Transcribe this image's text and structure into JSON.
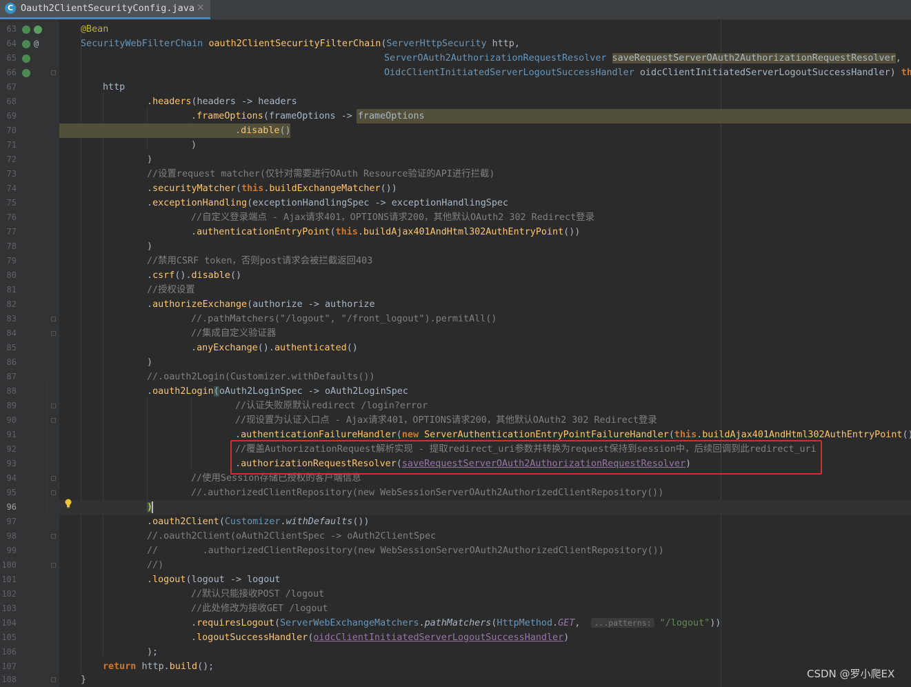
{
  "tab": {
    "title": "Oauth2ClientSecurityConfig.java",
    "close": "×",
    "icon_letter": "C"
  },
  "gutter": {
    "line_numbers": [
      "63",
      "64",
      "65",
      "66",
      "67",
      "68",
      "69",
      "70",
      "71",
      "72",
      "73",
      "74",
      "75",
      "76",
      "77",
      "78",
      "79",
      "80",
      "81",
      "82",
      "83",
      "84",
      "85",
      "86",
      "87",
      "88",
      "89",
      "90",
      "91",
      "92",
      "93",
      "94",
      "95",
      "96",
      "97",
      "98",
      "99",
      "100",
      "101",
      "102",
      "103",
      "104",
      "105",
      "106",
      "107",
      "108"
    ],
    "current_line": "96",
    "at_marker": "@"
  },
  "code": {
    "l63": {
      "annotation": "@Bean"
    },
    "l64": {
      "type": "SecurityWebFilterChain",
      "method": "oauth2ClientSecurityFilterChain",
      "open": "(",
      "ptype": "ServerHttpSecurity",
      "pname": "http,"
    },
    "l65": {
      "ptype": "ServerOAuth2AuthorizationRequestResolver",
      "pname": "saveRequestServerOAuth2AuthorizationRequestResolver",
      "comma": ","
    },
    "l66": {
      "ptype": "OidcClientInitiatedServerLogoutSuccessHandler",
      "pname": "oidcClientInitiatedServerLogoutSuccessHandler",
      "close": ")",
      "kw": "thr"
    },
    "l67": {
      "text": "http"
    },
    "l68": {
      "dot": ".",
      "method": "headers",
      "rest": "(headers -> headers"
    },
    "l69": {
      "dot": ".",
      "method": "frameOptions",
      "mid": "(frameOptions -> ",
      "tail": "frameOptions"
    },
    "l70": {
      "dot": ".",
      "method": "disable",
      "paren": "()"
    },
    "l71": {
      "text": ")"
    },
    "l72": {
      "text": ")"
    },
    "l73": {
      "comment": "//设置request matcher(仅针对需要进行OAuth Resource验证的API进行拦截)"
    },
    "l74": {
      "dot": ".",
      "method": "securityMatcher",
      "open": "(",
      "kw": "this",
      "dot2": ".",
      "method2": "buildExchangeMatcher",
      "close": "())"
    },
    "l75": {
      "dot": ".",
      "method": "exceptionHandling",
      "rest": "(exceptionHandlingSpec -> exceptionHandlingSpec"
    },
    "l76": {
      "comment": "//自定义登录端点 - Ajax请求401，OPTIONS请求200，其他默认OAuth2 302 Redirect登录"
    },
    "l77": {
      "dot": ".",
      "method": "authenticationEntryPoint",
      "open": "(",
      "kw": "this",
      "dot2": ".",
      "method2": "buildAjax401AndHtml302AuthEntryPoint",
      "close": "())"
    },
    "l78": {
      "text": ")"
    },
    "l79": {
      "comment": "//禁用CSRF token，否则post请求会被拦截返回403"
    },
    "l80": {
      "dot": ".",
      "method": "csrf",
      "paren": "()",
      "dot2": ".",
      "method2": "disable",
      "paren2": "()"
    },
    "l81": {
      "comment": "//授权设置"
    },
    "l82": {
      "dot": ".",
      "method": "authorizeExchange",
      "rest": "(authorize -> authorize"
    },
    "l83": {
      "comment": "//.pathMatchers(\"/logout\", \"/front_logout\").permitAll()"
    },
    "l84": {
      "comment": "//集成自定义验证器"
    },
    "l85": {
      "dot": ".",
      "method": "anyExchange",
      "paren": "()",
      "dot2": ".",
      "method2": "authenticated",
      "paren2": "()"
    },
    "l86": {
      "text": ")"
    },
    "l87": {
      "comment": "//.oauth2Login(Customizer.withDefaults())"
    },
    "l88": {
      "dot": ".",
      "method": "oauth2Login",
      "open": "(",
      "rest": "oAuth2LoginSpec -> oAuth2LoginSpec"
    },
    "l89": {
      "comment": "//认证失败原默认redirect /login?error"
    },
    "l90": {
      "comment": "//现设置为认证入口点 - Ajax请求401，OPTIONS请求200，其他默认OAuth2 302 Redirect登录"
    },
    "l91": {
      "dot": ".",
      "method": "authenticationFailureHandler",
      "open": "(",
      "kw": "new",
      "type": "ServerAuthenticationEntryPointFailureHandler",
      "open2": "(",
      "kw2": "this",
      "dot2": ".",
      "method2": "buildAjax401AndHtml302AuthEntryPoint",
      "close": "()"
    },
    "l92": {
      "comment": "//覆盖AuthorizationRequest解析实现 - 提取redirect_uri参数并转换为request保持到session中，后续回调到此redirect_uri"
    },
    "l93": {
      "dot": ".",
      "method": "authorizationRequestResolver",
      "open": "(",
      "param": "saveRequestServerOAuth2AuthorizationRequestResolver",
      "close": ")"
    },
    "l94": {
      "comment": "//使用Session存储已授权的客户端信息"
    },
    "l95": {
      "comment": "//.authorizedClientRepository(new WebSessionServerOAuth2AuthorizedClientRepository())"
    },
    "l96": {
      "text": ")"
    },
    "l97": {
      "dot": ".",
      "method": "oauth2Client",
      "open": "(",
      "type": "Customizer",
      "dot2": ".",
      "static": "withDefaults",
      "close": "())"
    },
    "l98": {
      "comment": "//.oauth2Client(oAuth2ClientSpec -> oAuth2ClientSpec"
    },
    "l99": {
      "comment": "//        .authorizedClientRepository(new WebSessionServerOAuth2AuthorizedClientRepository())"
    },
    "l100": {
      "comment": "//)"
    },
    "l101": {
      "dot": ".",
      "method": "logout",
      "rest": "(logout -> logout"
    },
    "l102": {
      "comment": "//默认只能接收POST /logout"
    },
    "l103": {
      "comment": "//此处修改为接收GET /logout"
    },
    "l104": {
      "dot": ".",
      "method": "requiresLogout",
      "open": "(",
      "type": "ServerWebExchangeMatchers",
      "dot2": ".",
      "static": "pathMatchers",
      "open2": "(",
      "type2": "HttpMethod",
      "dot3": ".",
      "field": "GET",
      "comma": ",",
      "hint": "...patterns:",
      "str": "\"/logout\"",
      "close": "))"
    },
    "l105": {
      "dot": ".",
      "method": "logoutSuccessHandler",
      "open": "(",
      "param": "oidcClientInitiatedServerLogoutSuccessHandler",
      "close": ")"
    },
    "l106": {
      "text": ");"
    },
    "l107": {
      "kw": "return",
      "rest": "http.",
      "method": "build",
      "close": "();"
    },
    "l108": {
      "text": "}"
    }
  },
  "watermark": "CSDN @罗小爬EX",
  "colors": {
    "keyword": "#cc7832",
    "method": "#ffc66d",
    "comment": "#808080",
    "annotation": "#bbb529",
    "highlight_box": "#e0282e",
    "background": "#2b2b2b"
  }
}
